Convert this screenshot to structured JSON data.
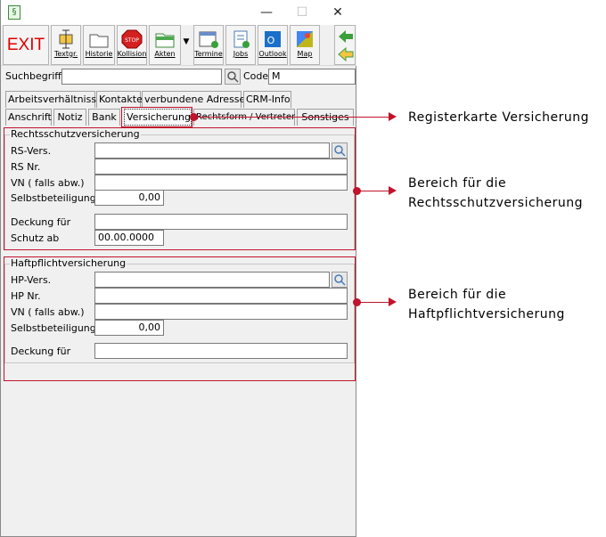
{
  "titlebar": {
    "app_icon_glyph": "§",
    "min_glyph": "—",
    "max_glyph": "☐",
    "close_glyph": "✕"
  },
  "toolbar": {
    "exit_label": "EXIT",
    "buttons": [
      {
        "label": "Textgr.",
        "icon": "textgr-icon"
      },
      {
        "label": "Historie",
        "icon": "folder-icon"
      },
      {
        "label": "Kollision",
        "icon": "stop-sign-icon",
        "icon_text": "STOP"
      },
      {
        "label": "Akten",
        "icon": "green-folder-icon"
      },
      {
        "label": "Termine",
        "icon": "calendar-icon"
      },
      {
        "label": "Jobs",
        "icon": "jobs-icon"
      },
      {
        "label": "Outlook",
        "icon": "outlook-icon",
        "icon_text": "O"
      },
      {
        "label": "Map",
        "icon": "map-icon",
        "icon_text": "G"
      }
    ],
    "dropdown_glyph": "▼"
  },
  "search": {
    "label": "Suchbegriff",
    "value": "",
    "code_label": "Code",
    "code_value": "M"
  },
  "tabs_row1": [
    "Arbeitsverhältnisse",
    "Kontakte",
    "verbundene Adressen",
    "CRM-Info"
  ],
  "tabs_row2": [
    "Anschrift",
    "Notiz",
    "Bank",
    "Versicherung",
    "Rechtsform / Vertreter",
    "Sonstiges"
  ],
  "rechtsschutz": {
    "title": "Rechtsschutzversicherung",
    "rs_vers_label": "RS-Vers.",
    "rs_vers_value": "",
    "rs_nr_label": "RS Nr.",
    "rs_nr_value": "",
    "vn_label": "VN ( falls abw.)",
    "vn_value": "",
    "sb_label": "Selbstbeteiligung",
    "sb_value": "0,00",
    "deckung_label": "Deckung für",
    "deckung_value": "",
    "schutz_label": "Schutz ab",
    "schutz_value": "00.00.0000"
  },
  "haftpflicht": {
    "title": "Haftpflichtversicherung",
    "hp_vers_label": "HP-Vers.",
    "hp_vers_value": "",
    "hp_nr_label": "HP Nr.",
    "hp_nr_value": "",
    "vn_label": "VN ( falls abw.)",
    "vn_value": "",
    "sb_label": "Selbstbeteiligung",
    "sb_value": "0,00",
    "deckung_label": "Deckung für",
    "deckung_value": ""
  },
  "annotations": {
    "note1": "Registerkarte  Versicherung",
    "note2_line1": "Bereich  für  die",
    "note2_line2": "Rechtsschutzversicherung",
    "note3_line1": "Bereich  für  die",
    "note3_line2": "Haftpflichtversicherung"
  },
  "colors": {
    "annotation_red": "#c0142c",
    "exit_red": "#e00000"
  }
}
